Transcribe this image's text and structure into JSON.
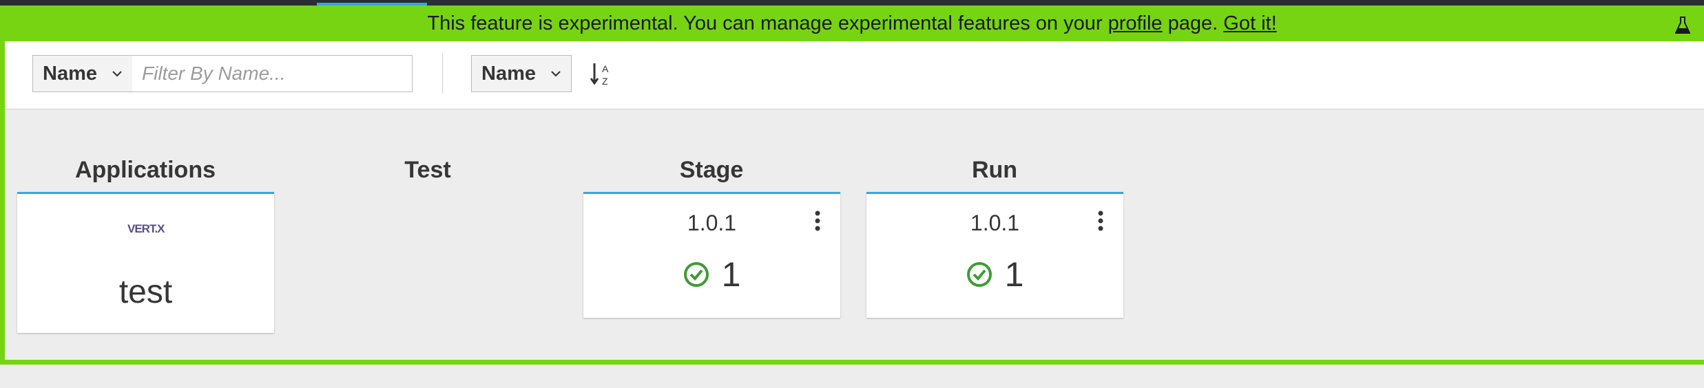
{
  "banner": {
    "text_before": "This feature is experimental. You can manage experimental features on your",
    "profile_link": "profile",
    "text_after": "page.",
    "got_it_link": "Got it!",
    "icon": "flask-icon",
    "color": "#76d413"
  },
  "toolbar": {
    "filter_field": "Name",
    "filter_placeholder": "Filter By Name...",
    "sort_field": "Name",
    "sort_icon": "sort-alpha-asc-icon"
  },
  "columns": {
    "applications": "Applications",
    "test": "Test",
    "stage": "Stage",
    "run": "Run"
  },
  "app_card": {
    "logo_text": "VERT.X",
    "name": "test"
  },
  "stage_card": {
    "version": "1.0.1",
    "count": "1",
    "status_icon": "check-circle-icon"
  },
  "run_card": {
    "version": "1.0.1",
    "count": "1",
    "status_icon": "check-circle-icon"
  },
  "colors": {
    "accent": "#39a5dc",
    "success": "#3f9c35"
  }
}
